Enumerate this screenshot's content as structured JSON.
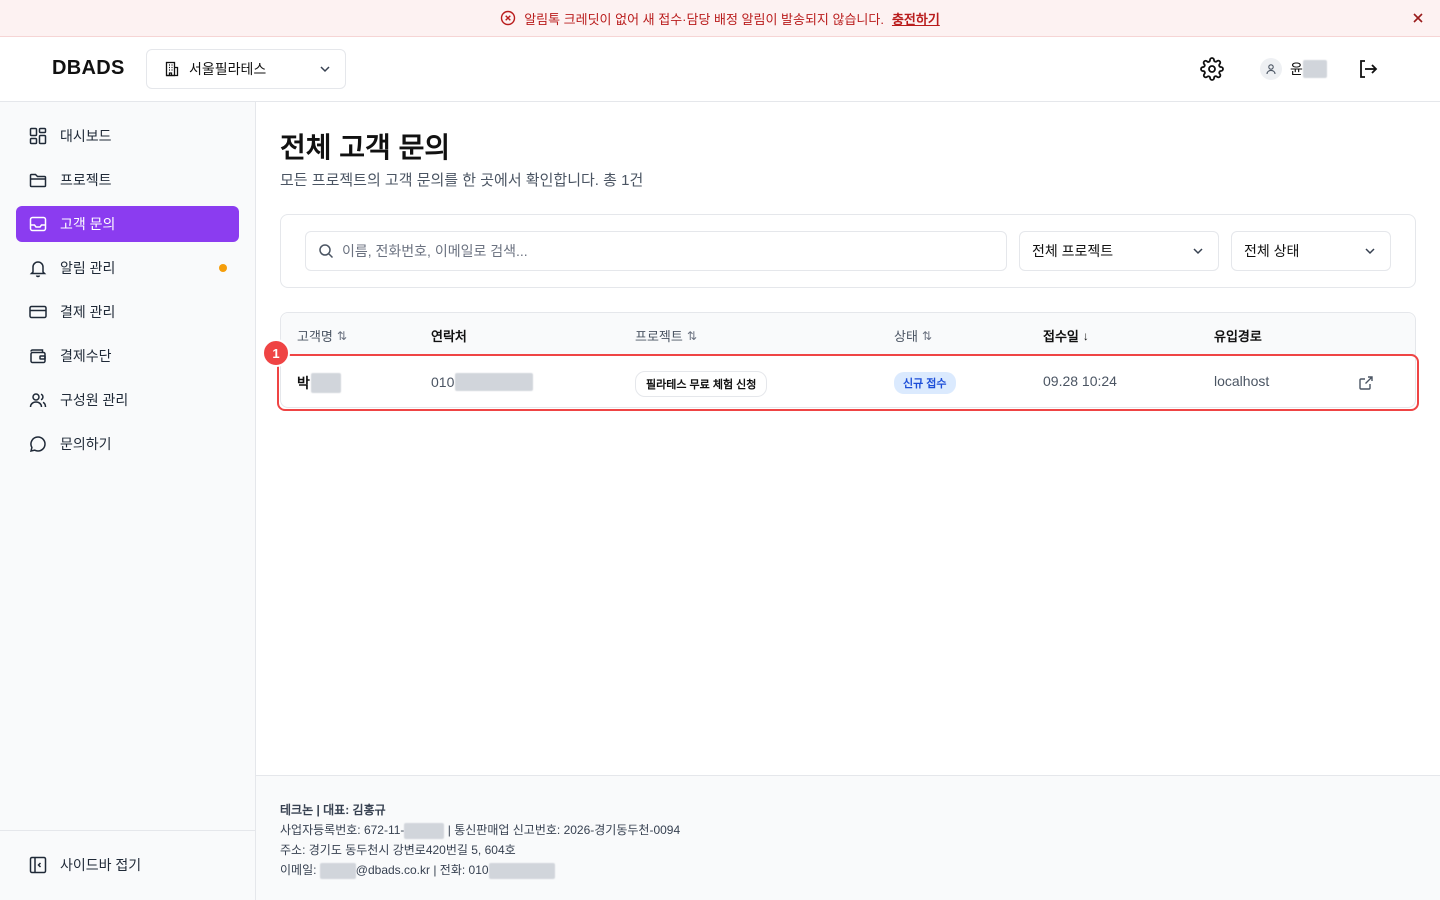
{
  "banner": {
    "message": "알림톡 크레딧이 없어 새 접수·담당 배정 알림이 발송되지 않습니다.",
    "cta": "충전하기"
  },
  "header": {
    "logo": "DBADS",
    "workspace": "서울필라테스",
    "user_initial": "윤"
  },
  "sidebar": {
    "items": [
      {
        "label": "대시보드",
        "icon": "dashboard-icon"
      },
      {
        "label": "프로젝트",
        "icon": "folder-icon"
      },
      {
        "label": "고객 문의",
        "icon": "inbox-icon",
        "active": true
      },
      {
        "label": "알림 관리",
        "icon": "bell-icon",
        "has_dot": true
      },
      {
        "label": "결제 관리",
        "icon": "credit-card-icon"
      },
      {
        "label": "결제수단",
        "icon": "wallet-icon"
      },
      {
        "label": "구성원 관리",
        "icon": "users-icon"
      },
      {
        "label": "문의하기",
        "icon": "chat-icon"
      }
    ],
    "collapse_label": "사이드바 접기"
  },
  "page": {
    "title": "전체 고객 문의",
    "subtitle": "모든 프로젝트의 고객 문의를 한 곳에서 확인합니다. 총 1건"
  },
  "filters": {
    "search_placeholder": "이름, 전화번호, 이메일로 검색...",
    "project_select": "전체 프로젝트",
    "status_select": "전체 상태"
  },
  "table": {
    "columns": [
      "고객명",
      "연락처",
      "프로젝트",
      "상태",
      "접수일",
      "유입경로"
    ],
    "rows": [
      {
        "name_prefix": "박",
        "phone_prefix": "010",
        "project": "필라테스 무료 체험 신청",
        "status": "신규 접수",
        "date": "09.28 10:24",
        "source": "localhost"
      }
    ]
  },
  "annotation": {
    "marker": "1"
  },
  "footer": {
    "line1": "테크논 | 대표: 김홍규",
    "biz_prefix": "사업자등록번호: 672-11-",
    "biz_suffix": " | 통신판매업 신고번호: 2026-경기동두천-0094",
    "address": "주소: 경기도 동두천시 강변로420번길 5, 604호",
    "email_prefix": "이메일: ",
    "email_suffix": "@dbads.co.kr | 전화: 010"
  },
  "colors": {
    "accent": "#8b3cf0",
    "danger": "#ef4444",
    "banner_text": "#b91c1c",
    "badge_bg": "#dbeafe",
    "badge_text": "#1d4ed8",
    "dot": "#f59e0b"
  }
}
